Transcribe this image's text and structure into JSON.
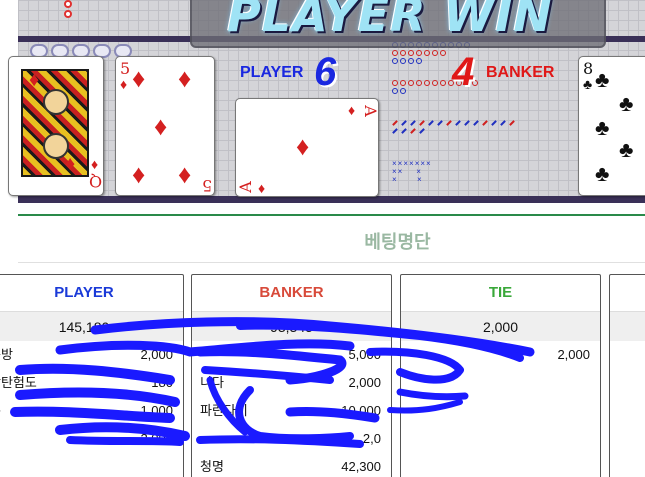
{
  "game": {
    "result_banner": "PLAYER WIN",
    "player_label": "PLAYER",
    "player_score": "6",
    "banker_label": "BANKER",
    "banker_score": "4",
    "player_cards": [
      {
        "rank": "Q",
        "suit": "♦",
        "color": "#d42020"
      },
      {
        "rank": "5",
        "suit": "♦",
        "color": "#d42020"
      },
      {
        "rank": "A",
        "suit": "♦",
        "color": "#d42020"
      }
    ],
    "banker_cards": [
      {
        "rank": "8",
        "suit": "♣",
        "color": "#111111"
      }
    ],
    "colors": {
      "player": "#1a28e0",
      "banker": "#e01818",
      "tie": "#2a9a2a"
    }
  },
  "betting": {
    "title": "베팅명단",
    "columns": [
      {
        "label": "PLAYER",
        "total": "145,180",
        "rows": [
          {
            "name": "는방",
            "amount": "2,000"
          },
          {
            "name": "방탄험도",
            "amount": "180"
          },
          {
            "name": "쫀",
            "amount": "1,000"
          },
          {
            "name": "킴",
            "amount": "2,000"
          }
        ]
      },
      {
        "label": "BANKER",
        "total": "93,345",
        "rows": [
          {
            "name": "",
            "amount": "5,000"
          },
          {
            "name": "니다",
            "amount": "2,000"
          },
          {
            "name": "파란다이",
            "amount": "10,000"
          },
          {
            "name": "",
            "amount": "2,0"
          },
          {
            "name": "청명",
            "amount": "42,300"
          }
        ]
      },
      {
        "label": "TIE",
        "total": "2,000",
        "rows": [
          {
            "name": "",
            "amount": "2,000"
          }
        ]
      }
    ]
  }
}
